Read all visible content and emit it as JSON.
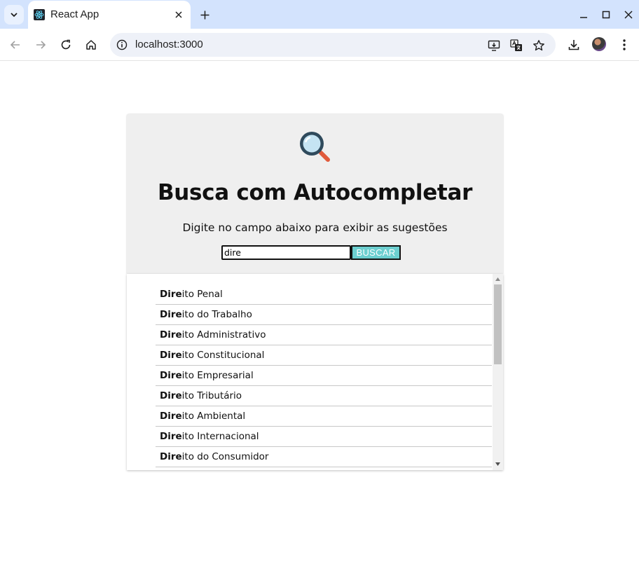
{
  "browser": {
    "tab_title": "React App",
    "url": "localhost:3000",
    "icons": [
      "tab-list-icon",
      "react-favicon-icon",
      "close-icon",
      "plus-icon",
      "minimize-icon",
      "maximize-icon",
      "window-close-icon",
      "back-arrow-icon",
      "forward-arrow-icon",
      "reload-icon",
      "home-icon",
      "info-icon",
      "install-app-icon",
      "translate-icon",
      "star-icon",
      "download-icon",
      "kebab-menu-icon"
    ]
  },
  "app": {
    "title": "Busca com Autocompletar",
    "subtitle": "Digite no campo abaixo para exibir as sugestões",
    "search_value": "dire",
    "search_button": "BUSCAR",
    "match_prefix": "Dire",
    "suggestions": [
      {
        "prefix": "Dire",
        "rest": "ito Penal"
      },
      {
        "prefix": "Dire",
        "rest": "ito do Trabalho"
      },
      {
        "prefix": "Dire",
        "rest": "ito Administrativo"
      },
      {
        "prefix": "Dire",
        "rest": "ito Constitucional"
      },
      {
        "prefix": "Dire",
        "rest": "ito Empresarial"
      },
      {
        "prefix": "Dire",
        "rest": "ito Tributário"
      },
      {
        "prefix": "Dire",
        "rest": "ito Ambiental"
      },
      {
        "prefix": "Dire",
        "rest": "ito Internacional"
      },
      {
        "prefix": "Dire",
        "rest": "ito do Consumidor"
      }
    ]
  },
  "colors": {
    "tabbar": "#d3e3fd",
    "card_bg": "#efefef",
    "button_bg": "#6ccfd0",
    "logo_lens": "#2f4a5c",
    "logo_handle": "#e05a3c"
  }
}
